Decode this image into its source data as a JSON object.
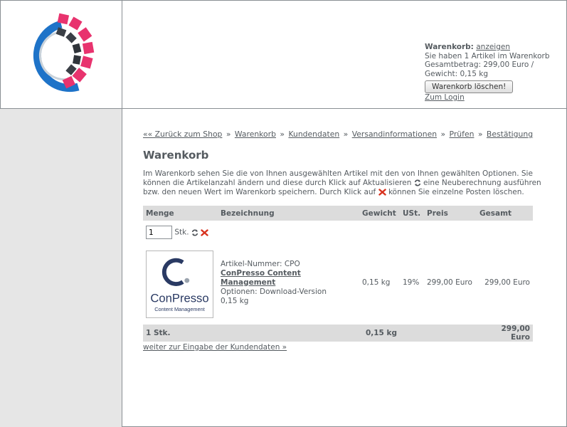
{
  "cart_box": {
    "title": "Warenkorb:",
    "show_link": "anzeigen",
    "line_items": "Sie haben 1 Artikel im Warenkorb",
    "line_total": "Gesamtbetrag: 299,00 Euro /",
    "line_weight": "Gewicht: 0,15 kg",
    "clear_button": "Warenkorb löschen!",
    "login_link": "Zum Login"
  },
  "breadcrumb": {
    "back": "«« Zurück zum Shop",
    "sep": "»",
    "items": [
      "Warenkorb",
      "Kundendaten",
      "Versandinformationen",
      "Prüfen",
      "Bestätigung"
    ]
  },
  "page_title": "Warenkorb",
  "intro": {
    "part1": "Im Warenkorb sehen Sie die von Ihnen ausgewählten Artikel mit den von Ihnen gewählten Optionen. Sie können die Artikelanzahl ändern und diese durch Klick auf Aktualisieren",
    "part2": "eine Neuberechnung ausführen bzw. den neuen Wert im Warenkorb speichern. Durch Klick auf",
    "part3": "können Sie einzelne Posten löschen."
  },
  "table": {
    "headers": {
      "qty": "Menge",
      "name": "Bezeichnung",
      "weight": "Gewicht",
      "vat": "USt.",
      "price": "Preis",
      "total": "Gesamt"
    },
    "item": {
      "qty_value": "1",
      "qty_unit": "Stk.",
      "sku": "Artikel-Nummer: CPO",
      "name": "ConPresso Content Management",
      "options": "Optionen: Download-Version",
      "item_weight": "0,15 kg",
      "weight": "0,15 kg",
      "vat": "19%",
      "price": "299,00 Euro",
      "total": "299,00 Euro",
      "image_brand": "ConPresso",
      "image_tagline": "Content Management"
    },
    "summary": {
      "qty": "1 Stk.",
      "weight": "0,15 kg",
      "total": "299,00 Euro"
    }
  },
  "next_link": "weiter zur Eingabe der Kundendaten »",
  "colors": {
    "border": "#8a8f94",
    "sidebar": "#e6e6e6",
    "header_row": "#dcdcdc",
    "logo_blue": "#1e73c8",
    "logo_pink": "#e8336e",
    "text": "#555b60"
  }
}
